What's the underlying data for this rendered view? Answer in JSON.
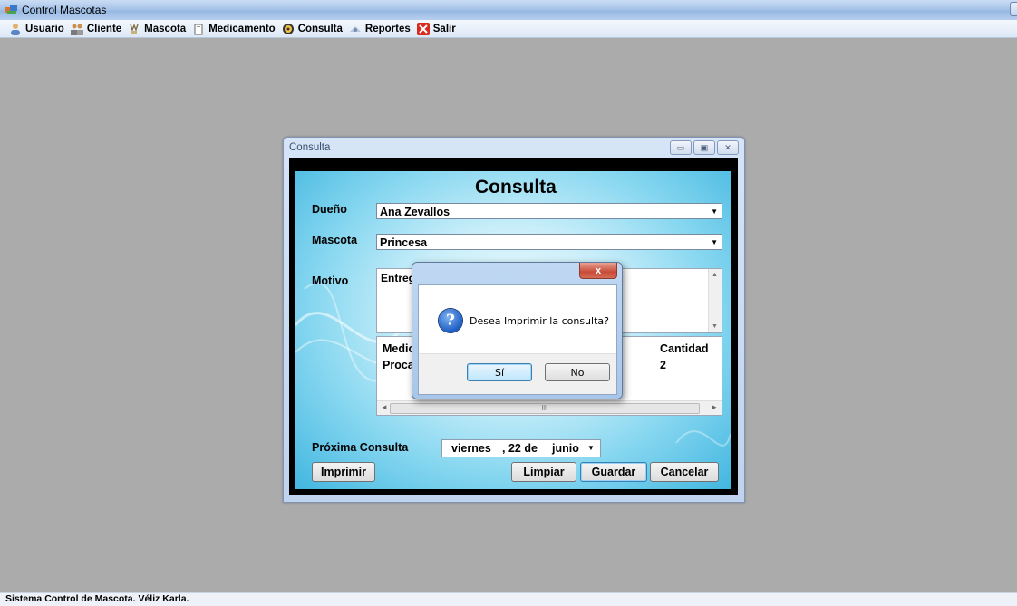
{
  "app": {
    "title": "Control Mascotas"
  },
  "menu": [
    {
      "label": "Usuario",
      "icon": "user-icon"
    },
    {
      "label": "Cliente",
      "icon": "clients-icon"
    },
    {
      "label": "Mascota",
      "icon": "pet-icon"
    },
    {
      "label": "Medicamento",
      "icon": "medicine-icon"
    },
    {
      "label": "Consulta",
      "icon": "consult-icon"
    },
    {
      "label": "Reportes",
      "icon": "reports-icon"
    },
    {
      "label": "Salir",
      "icon": "exit-icon"
    }
  ],
  "status": {
    "text": "Sistema Control de Mascota. Véliz Karla."
  },
  "consulta_window": {
    "title": "Consulta",
    "heading": "Consulta",
    "owner_label": "Dueño",
    "owner_value": "Ana Zevallos",
    "pet_label": "Mascota",
    "pet_value": "Princesa",
    "reason_label": "Motivo",
    "reason_value": "Entrega",
    "grid_headers": [
      "Medic",
      "Cantidad"
    ],
    "grid_rows": [
      [
        "Procai",
        "2"
      ]
    ],
    "next_label": "Próxima Consulta",
    "date_day": "viernes",
    "date_num": ", 22 de",
    "date_month": "junio",
    "buttons": {
      "print": "Imprimir",
      "clear": "Limpiar",
      "save": "Guardar",
      "cancel": "Cancelar"
    }
  },
  "dialog": {
    "message": "Desea Imprimir la consulta?",
    "yes": "Sí",
    "no": "No",
    "close": "x"
  },
  "colors": {
    "mdi_background": "#ababab",
    "form_gradient": "#87d7f0",
    "default_button_border": "#3c7fb1"
  }
}
